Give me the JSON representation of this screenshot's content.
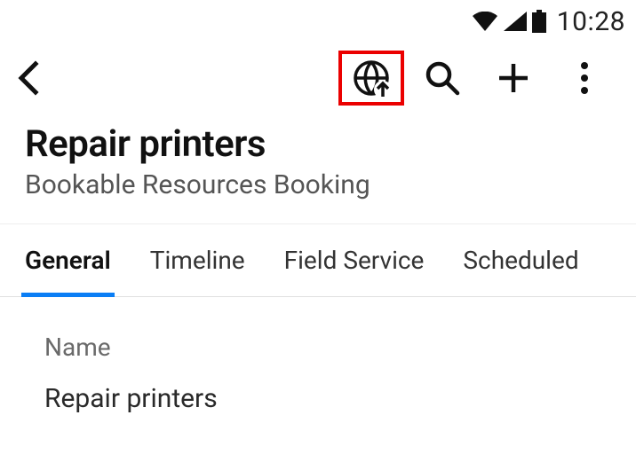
{
  "statusbar": {
    "time": "10:28"
  },
  "header": {
    "title": "Repair printers",
    "subtitle": "Bookable Resources Booking"
  },
  "tabs": [
    {
      "label": "General",
      "active": true
    },
    {
      "label": "Timeline",
      "active": false
    },
    {
      "label": "Field Service",
      "active": false
    },
    {
      "label": "Scheduled",
      "active": false
    }
  ],
  "form": {
    "name": {
      "label": "Name",
      "value": "Repair printers"
    }
  }
}
